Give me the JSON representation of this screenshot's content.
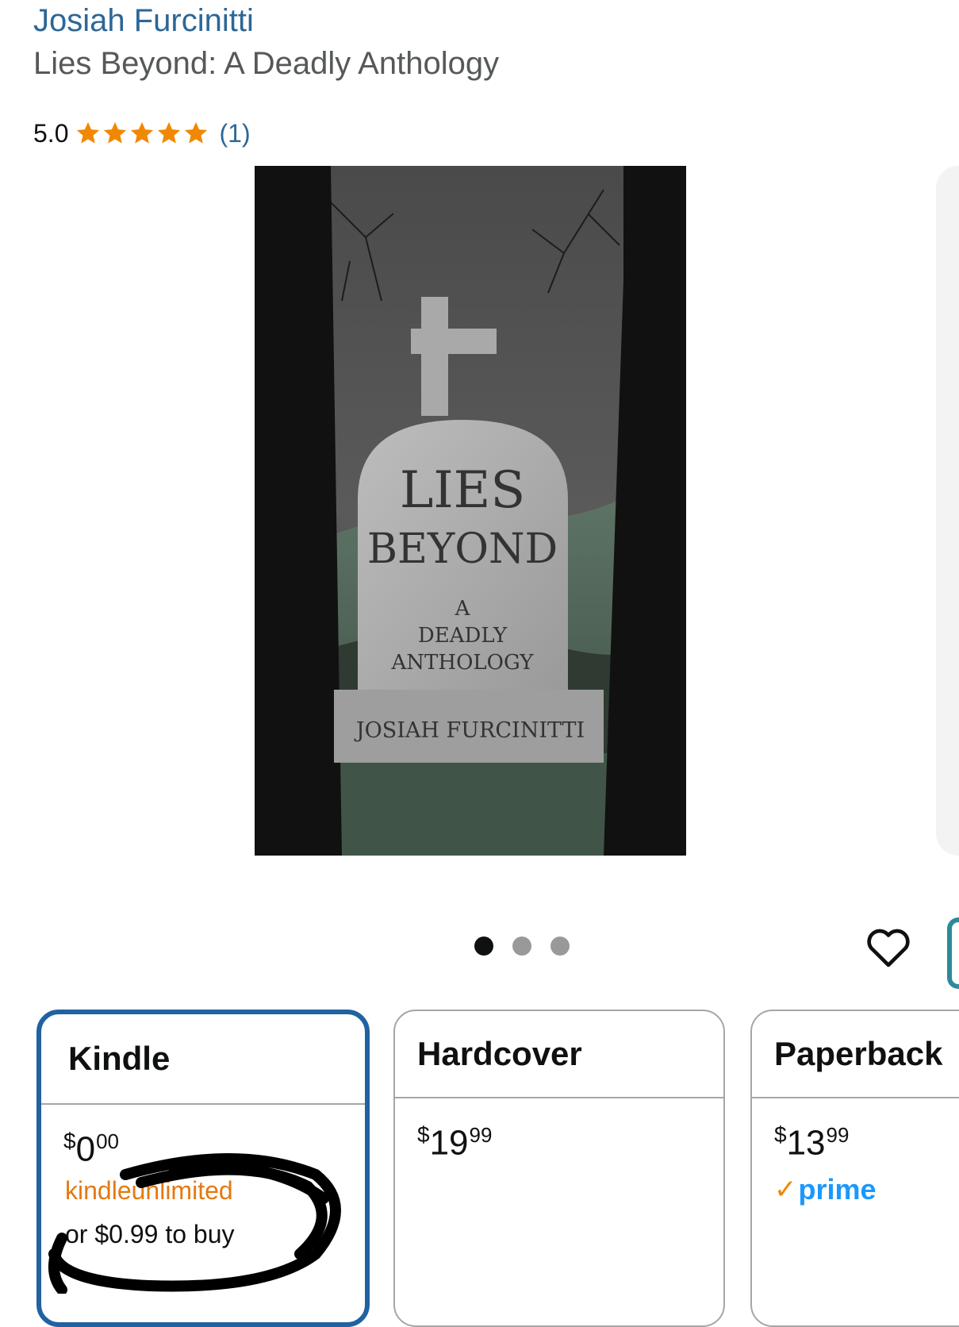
{
  "product": {
    "author": "Josiah Furcinitti",
    "title": "Lies Beyond: A Deadly Anthology",
    "rating": {
      "value": "5.0",
      "stars": 5,
      "count": "(1)"
    },
    "cover": {
      "title_line1": "LIES",
      "title_line2": "BEYOND",
      "subtitle_line1": "A",
      "subtitle_line2": "DEADLY",
      "subtitle_line3": "ANTHOLOGY",
      "author": "JOSIAH FURCINITTI"
    }
  },
  "carousel": {
    "total": 3,
    "active": 1
  },
  "formats": [
    {
      "name": "Kindle",
      "currency": "$",
      "price_whole": "0",
      "price_fraction": "00",
      "ku_text": "kindleunlimited",
      "buy_text": "or $0.99 to buy",
      "selected": true
    },
    {
      "name": "Hardcover",
      "currency": "$",
      "price_whole": "19",
      "price_fraction": "99",
      "selected": false
    },
    {
      "name": "Paperback",
      "currency": "$",
      "price_whole": "13",
      "price_fraction": "99",
      "prime_label": "prime",
      "selected": false
    }
  ],
  "colors": {
    "link": "#2c6796",
    "star": "#f08804",
    "selected_border": "#2162a1",
    "prime": "#1a98ff"
  },
  "icons": [
    "star-icon",
    "heart-icon",
    "prime-check-icon"
  ]
}
